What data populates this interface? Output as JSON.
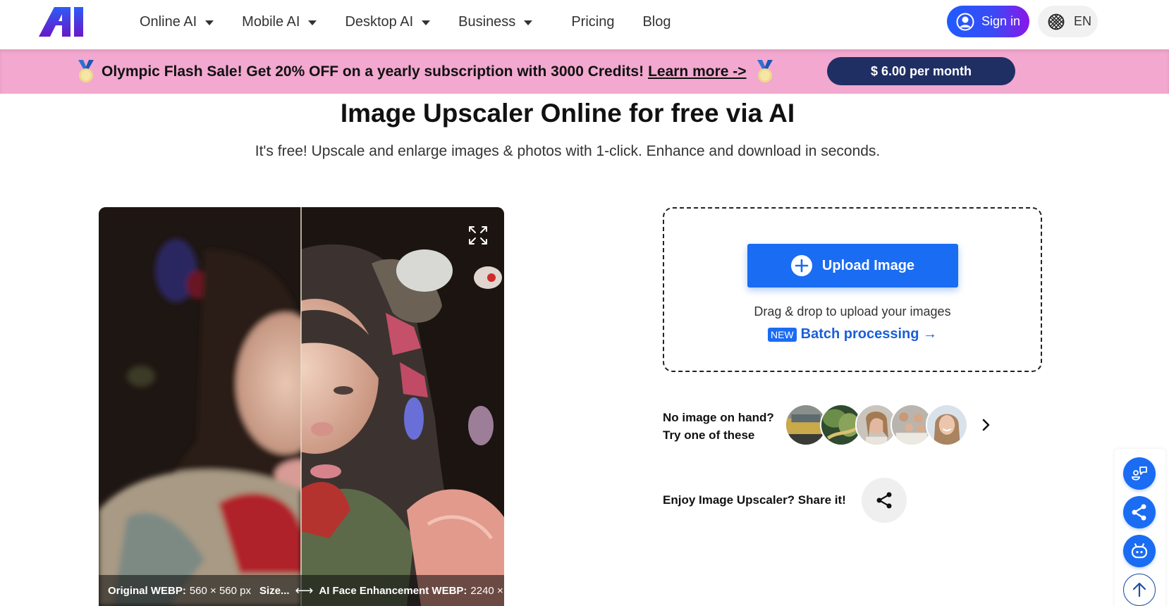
{
  "header": {
    "logo_text": "AI",
    "nav": [
      {
        "label": "Online AI",
        "has_dropdown": true
      },
      {
        "label": "Mobile AI",
        "has_dropdown": true
      },
      {
        "label": "Desktop AI",
        "has_dropdown": true
      },
      {
        "label": "Business",
        "has_dropdown": true
      },
      {
        "label": "Pricing",
        "has_dropdown": false
      },
      {
        "label": "Blog",
        "has_dropdown": false
      }
    ],
    "sign_in_label": "Sign in",
    "language_label": "EN"
  },
  "promo": {
    "text": "Olympic Flash Sale! Get 20% OFF on a yearly subscription with 3000 Credits!",
    "link_label": "Learn more ->",
    "price_button_label": "$ 6.00 per month",
    "background_color": "#f2a8cf",
    "price_button_color": "#1f2f64"
  },
  "hero": {
    "title": "Image Upscaler Online for free via AI",
    "subtitle": "It's free! Upscale and enlarge images & photos with 1-click. Enhance and download in seconds."
  },
  "compare": {
    "original_label": "Original WEBP:",
    "original_value": "560 × 560 px",
    "size_label": "Size...",
    "arrows": "⟷",
    "enhanced_label": "AI Face Enhancement WEBP:",
    "enhanced_value": "2240 ×..."
  },
  "upload": {
    "button_label": "Upload Image",
    "drag_text": "Drag & drop to upload your images",
    "badge": "NEW",
    "batch_label": "Batch processing →",
    "accent_color": "#1a6cf3"
  },
  "samples": {
    "line1": "No image on hand?",
    "line2": "Try one of these",
    "thumbnails": [
      "yellow-car",
      "forest-road",
      "woman-portrait",
      "family-photo",
      "smiling-woman"
    ]
  },
  "share": {
    "label": "Enjoy Image Upscaler? Share it!"
  },
  "side_buttons": [
    "feedback-icon",
    "share-icon",
    "ai-bot-icon",
    "back-to-top-icon"
  ]
}
